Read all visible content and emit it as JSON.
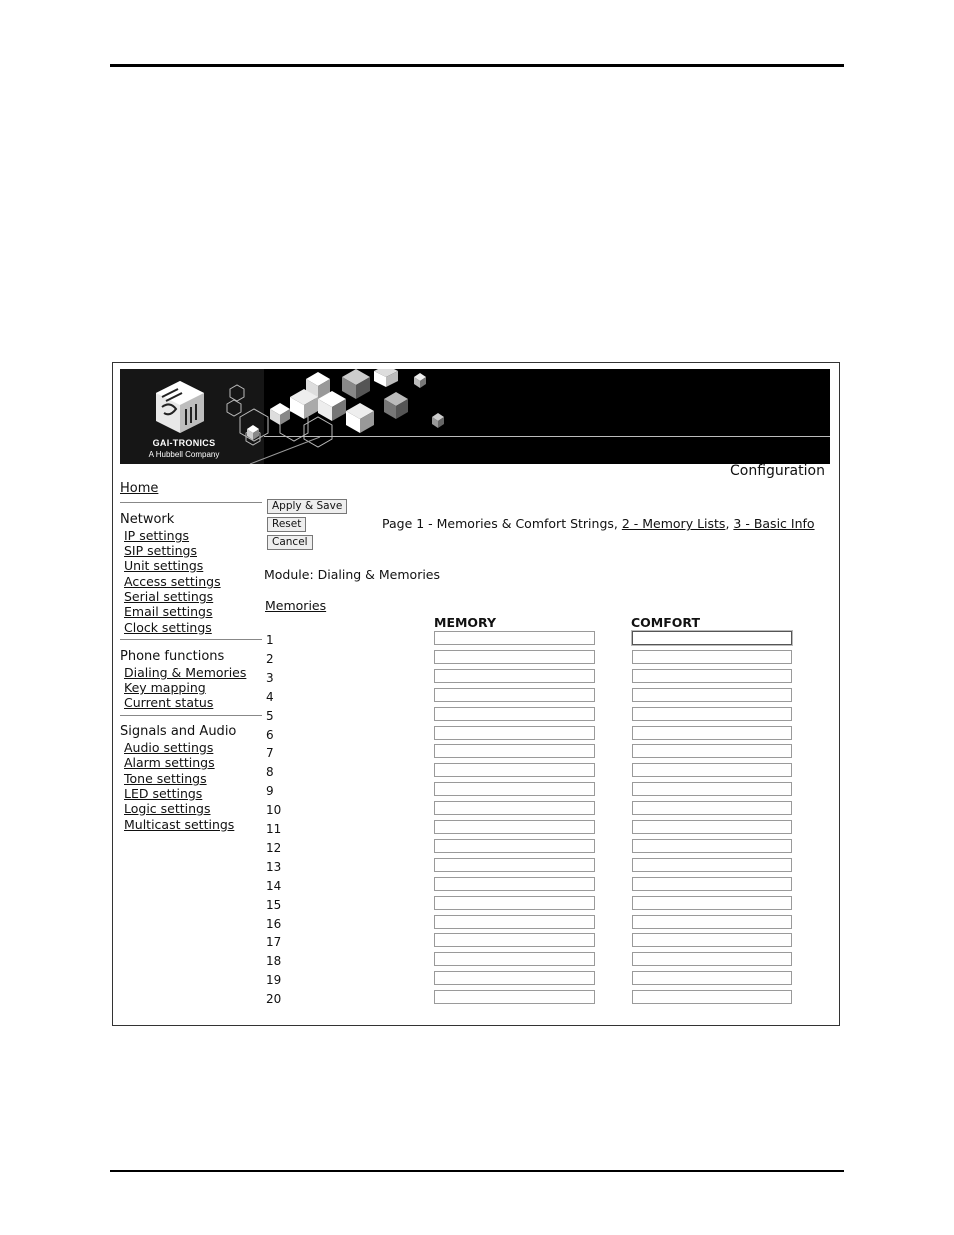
{
  "banner": {
    "brand": "GAI-TRONICS",
    "tagline": "A Hubbell Company"
  },
  "page": {
    "title": "Configuration"
  },
  "sidebar": {
    "home": "Home",
    "groups": [
      {
        "title": "Network",
        "links": [
          "IP settings",
          "SIP settings",
          "Unit settings",
          "Access settings",
          "Serial settings",
          "Email settings",
          "Clock settings"
        ]
      },
      {
        "title": "Phone functions",
        "links": [
          "Dialing & Memories",
          "Key mapping",
          "Current status"
        ]
      },
      {
        "title": "Signals and Audio",
        "links": [
          "Audio settings",
          "Alarm settings",
          "Tone settings",
          "LED settings",
          "Logic settings",
          "Multicast settings"
        ]
      }
    ]
  },
  "buttons": {
    "apply_save": "Apply & Save",
    "reset": "Reset",
    "cancel": "Cancel"
  },
  "pager": {
    "current": "Page 1 - Memories & Comfort Strings,",
    "link2": "2 - Memory Lists",
    "sep": ",",
    "link3": "3 - Basic Info"
  },
  "module": "Module: Dialing & Memories",
  "memories_link": "Memories",
  "table": {
    "memory_header": "MEMORY",
    "comfort_header": "COMFORT",
    "rows": [
      "1",
      "2",
      "3",
      "4",
      "5",
      "6",
      "7",
      "8",
      "9",
      "10",
      "11",
      "12",
      "13",
      "14",
      "15",
      "16",
      "17",
      "18",
      "19",
      "20"
    ],
    "memory_values": [
      "",
      "",
      "",
      "",
      "",
      "",
      "",
      "",
      "",
      "",
      "",
      "",
      "",
      "",
      "",
      "",
      "",
      "",
      "",
      ""
    ],
    "comfort_values": [
      "",
      "",
      "",
      "",
      "",
      "",
      "",
      "",
      "",
      "",
      "",
      "",
      "",
      "",
      "",
      "",
      "",
      "",
      "",
      ""
    ]
  }
}
